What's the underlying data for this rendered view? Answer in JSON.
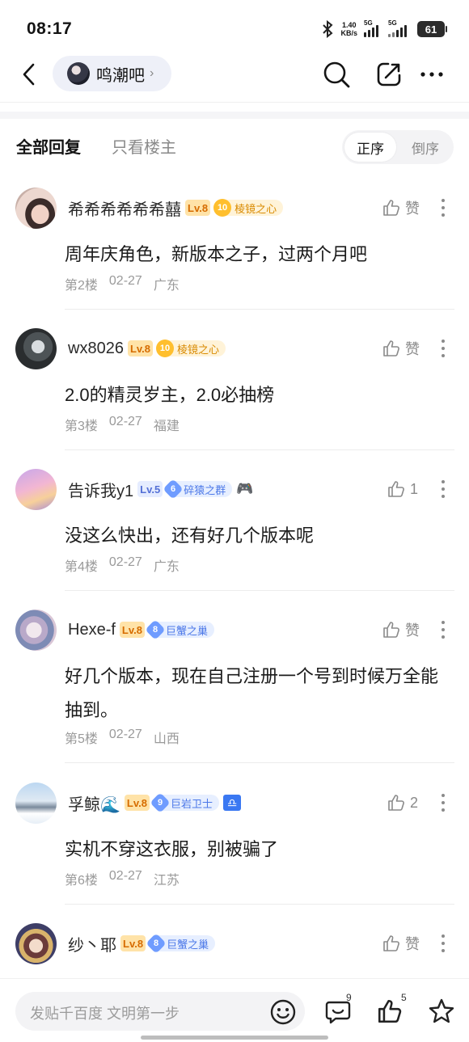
{
  "status_bar": {
    "time": "08:17",
    "net_speed_value": "1.40",
    "net_speed_unit": "KB/s",
    "sim1": "5G",
    "sim2": "5G",
    "battery": "61"
  },
  "header": {
    "forum_name": "鸣潮吧",
    "chevron": "›"
  },
  "filter": {
    "all_replies": "全部回复",
    "owner_only": "只看楼主",
    "sort_asc": "正序",
    "sort_desc": "倒序"
  },
  "posts": [
    {
      "username": "希希希希希希囍",
      "level": "Lv.8",
      "badge_num": "10",
      "badge_name": "棱镜之心",
      "like_label": "赞",
      "content": "周年庆角色，新版本之子，过两个月吧",
      "floor": "第2楼",
      "date": "02-27",
      "location": "广东"
    },
    {
      "username": "wx8026",
      "level": "Lv.8",
      "badge_num": "10",
      "badge_name": "棱镜之心",
      "like_label": "赞",
      "content": "2.0的精灵岁主，2.0必抽榜",
      "floor": "第3楼",
      "date": "02-27",
      "location": "福建"
    },
    {
      "username": "告诉我y1",
      "level": "Lv.5",
      "badge_num": "6",
      "badge_name": "碎猿之群",
      "like_label": "1",
      "content": "没这么快出，还有好几个版本呢",
      "floor": "第4楼",
      "date": "02-27",
      "location": "广东"
    },
    {
      "username": "Hexe-f",
      "level": "Lv.8",
      "badge_num": "8",
      "badge_name": "巨蟹之巢",
      "like_label": "赞",
      "content": "好几个版本，现在自己注册一个号到时候万全能抽到。",
      "floor": "第5楼",
      "date": "02-27",
      "location": "山西"
    },
    {
      "username": "孚鲸🌊",
      "level": "Lv.8",
      "badge_num": "9",
      "badge_name": "巨岩卫士",
      "like_label": "2",
      "content": "实机不穿这衣服，别被骗了",
      "floor": "第6楼",
      "date": "02-27",
      "location": "江苏"
    },
    {
      "username": "纱丶耶",
      "level": "Lv.8",
      "badge_num": "8",
      "badge_name": "巨蟹之巢",
      "like_label": "赞"
    }
  ],
  "bottom_bar": {
    "reply_placeholder": "发贴千百度 文明第一步",
    "comment_count": "9",
    "like_count": "5"
  },
  "icons": {
    "back": "back-arrow-icon",
    "search": "search-icon",
    "share": "share-icon",
    "more": "more-dots-icon",
    "like": "thumbs-up-icon",
    "comment": "comment-icon",
    "favorite": "star-icon",
    "emoji": "emoji-icon"
  },
  "colors": {
    "level_orange": "#d66c00",
    "badge_gold": "#ffbf2e",
    "badge_blue": "#6f9cff",
    "muted_text": "#9a9a9a"
  }
}
